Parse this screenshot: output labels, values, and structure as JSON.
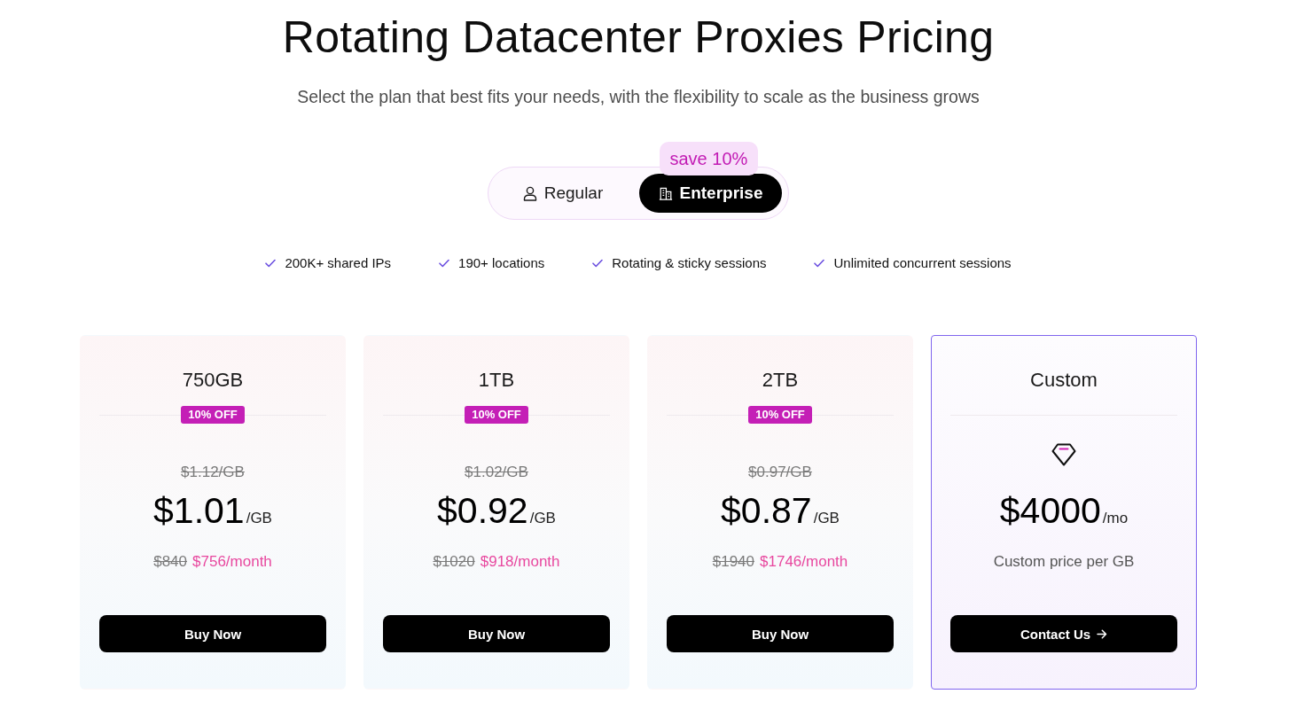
{
  "header": {
    "title": "Rotating Datacenter Proxies Pricing",
    "subtitle": "Select the plan that best fits your needs, with the flexibility to scale as the business grows"
  },
  "plan_toggle": {
    "badge": "save 10%",
    "options": [
      {
        "label": "Regular",
        "selected": false
      },
      {
        "label": "Enterprise",
        "selected": true
      }
    ]
  },
  "features": [
    "200K+ shared IPs",
    "190+ locations",
    "Rotating & sticky sessions",
    "Unlimited concurrent sessions"
  ],
  "plans": [
    {
      "kind": "standard",
      "highlighted": false,
      "name": "750GB",
      "discount": "10% OFF",
      "old_price": "$1.12/GB",
      "price": "$1.01",
      "unit": "/GB",
      "old_monthly": "$840",
      "monthly": "$756/month",
      "button": "Buy Now"
    },
    {
      "kind": "standard",
      "highlighted": false,
      "name": "1TB",
      "discount": "10% OFF",
      "old_price": "$1.02/GB",
      "price": "$0.92",
      "unit": "/GB",
      "old_monthly": "$1020",
      "monthly": "$918/month",
      "button": "Buy Now"
    },
    {
      "kind": "standard",
      "highlighted": false,
      "name": "2TB",
      "discount": "10% OFF",
      "old_price": "$0.97/GB",
      "price": "$0.87",
      "unit": "/GB",
      "old_monthly": "$1940",
      "monthly": "$1746/month",
      "button": "Buy Now"
    },
    {
      "kind": "custom",
      "highlighted": true,
      "name": "Custom",
      "price": "$4000",
      "unit": "/mo",
      "note": "Custom price per GB",
      "button": "Contact Us"
    }
  ]
}
